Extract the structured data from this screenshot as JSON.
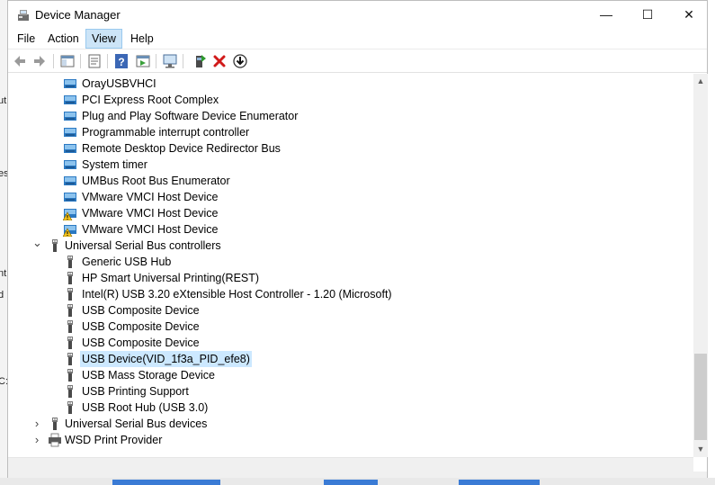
{
  "window": {
    "title": "Device Manager"
  },
  "controls": {
    "minimize": "—",
    "maximize": "☐",
    "close": "✕"
  },
  "menu": [
    {
      "label": "File"
    },
    {
      "label": "Action"
    },
    {
      "label": "View"
    },
    {
      "label": "Help"
    }
  ],
  "active_menu": "View",
  "toolbar": [
    "back-icon",
    "forward-icon",
    "show-hide-tree-icon",
    "properties-icon",
    "help-icon",
    "update-driver-view-icon",
    "scan-hardware-icon",
    "enable-device-icon",
    "uninstall-icon",
    "download-driver-icon"
  ],
  "tree": [
    {
      "label": "OrayUSBVHCI",
      "icon": "system-device-icon"
    },
    {
      "label": "PCI Express Root Complex",
      "icon": "system-device-icon"
    },
    {
      "label": "Plug and Play Software Device Enumerator",
      "icon": "system-device-icon"
    },
    {
      "label": "Programmable interrupt controller",
      "icon": "system-device-icon"
    },
    {
      "label": "Remote Desktop Device Redirector Bus",
      "icon": "system-device-icon"
    },
    {
      "label": "System timer",
      "icon": "system-device-icon"
    },
    {
      "label": "UMBus Root Bus Enumerator",
      "icon": "system-device-icon"
    },
    {
      "label": "VMware VMCI Host Device",
      "icon": "system-device-icon"
    },
    {
      "label": "VMware VMCI Host Device",
      "icon": "warning-device-icon"
    },
    {
      "label": "VMware VMCI Host Device",
      "icon": "warning-device-icon"
    },
    {
      "label": "Universal Serial Bus controllers",
      "icon": "usb-icon",
      "category": true,
      "expanded": true
    },
    {
      "label": "Generic USB Hub",
      "icon": "usb-icon"
    },
    {
      "label": "HP Smart Universal Printing(REST)",
      "icon": "usb-icon"
    },
    {
      "label": "Intel(R) USB 3.20 eXtensible Host Controller - 1.20 (Microsoft)",
      "icon": "usb-icon"
    },
    {
      "label": "USB Composite Device",
      "icon": "usb-icon"
    },
    {
      "label": "USB Composite Device",
      "icon": "usb-icon"
    },
    {
      "label": "USB Composite Device",
      "icon": "usb-icon"
    },
    {
      "label": "USB Device(VID_1f3a_PID_efe8)",
      "icon": "usb-icon",
      "selected": true
    },
    {
      "label": "USB Mass Storage Device",
      "icon": "usb-icon"
    },
    {
      "label": "USB Printing Support",
      "icon": "usb-icon"
    },
    {
      "label": "USB Root Hub (USB 3.0)",
      "icon": "usb-icon"
    },
    {
      "label": "Universal Serial Bus devices",
      "icon": "usb-icon",
      "category": true,
      "expanded": false
    },
    {
      "label": "WSD Print Provider",
      "icon": "printer-icon",
      "category": true,
      "expanded": false
    }
  ],
  "background_fragments": [
    "ut",
    "es",
    "nt",
    "d",
    "C:"
  ],
  "colors": {
    "selection": "#cce8ff",
    "menu_active": "#cce4f7",
    "warning": "#f2c21a",
    "device_blue": "#2b79c2"
  }
}
